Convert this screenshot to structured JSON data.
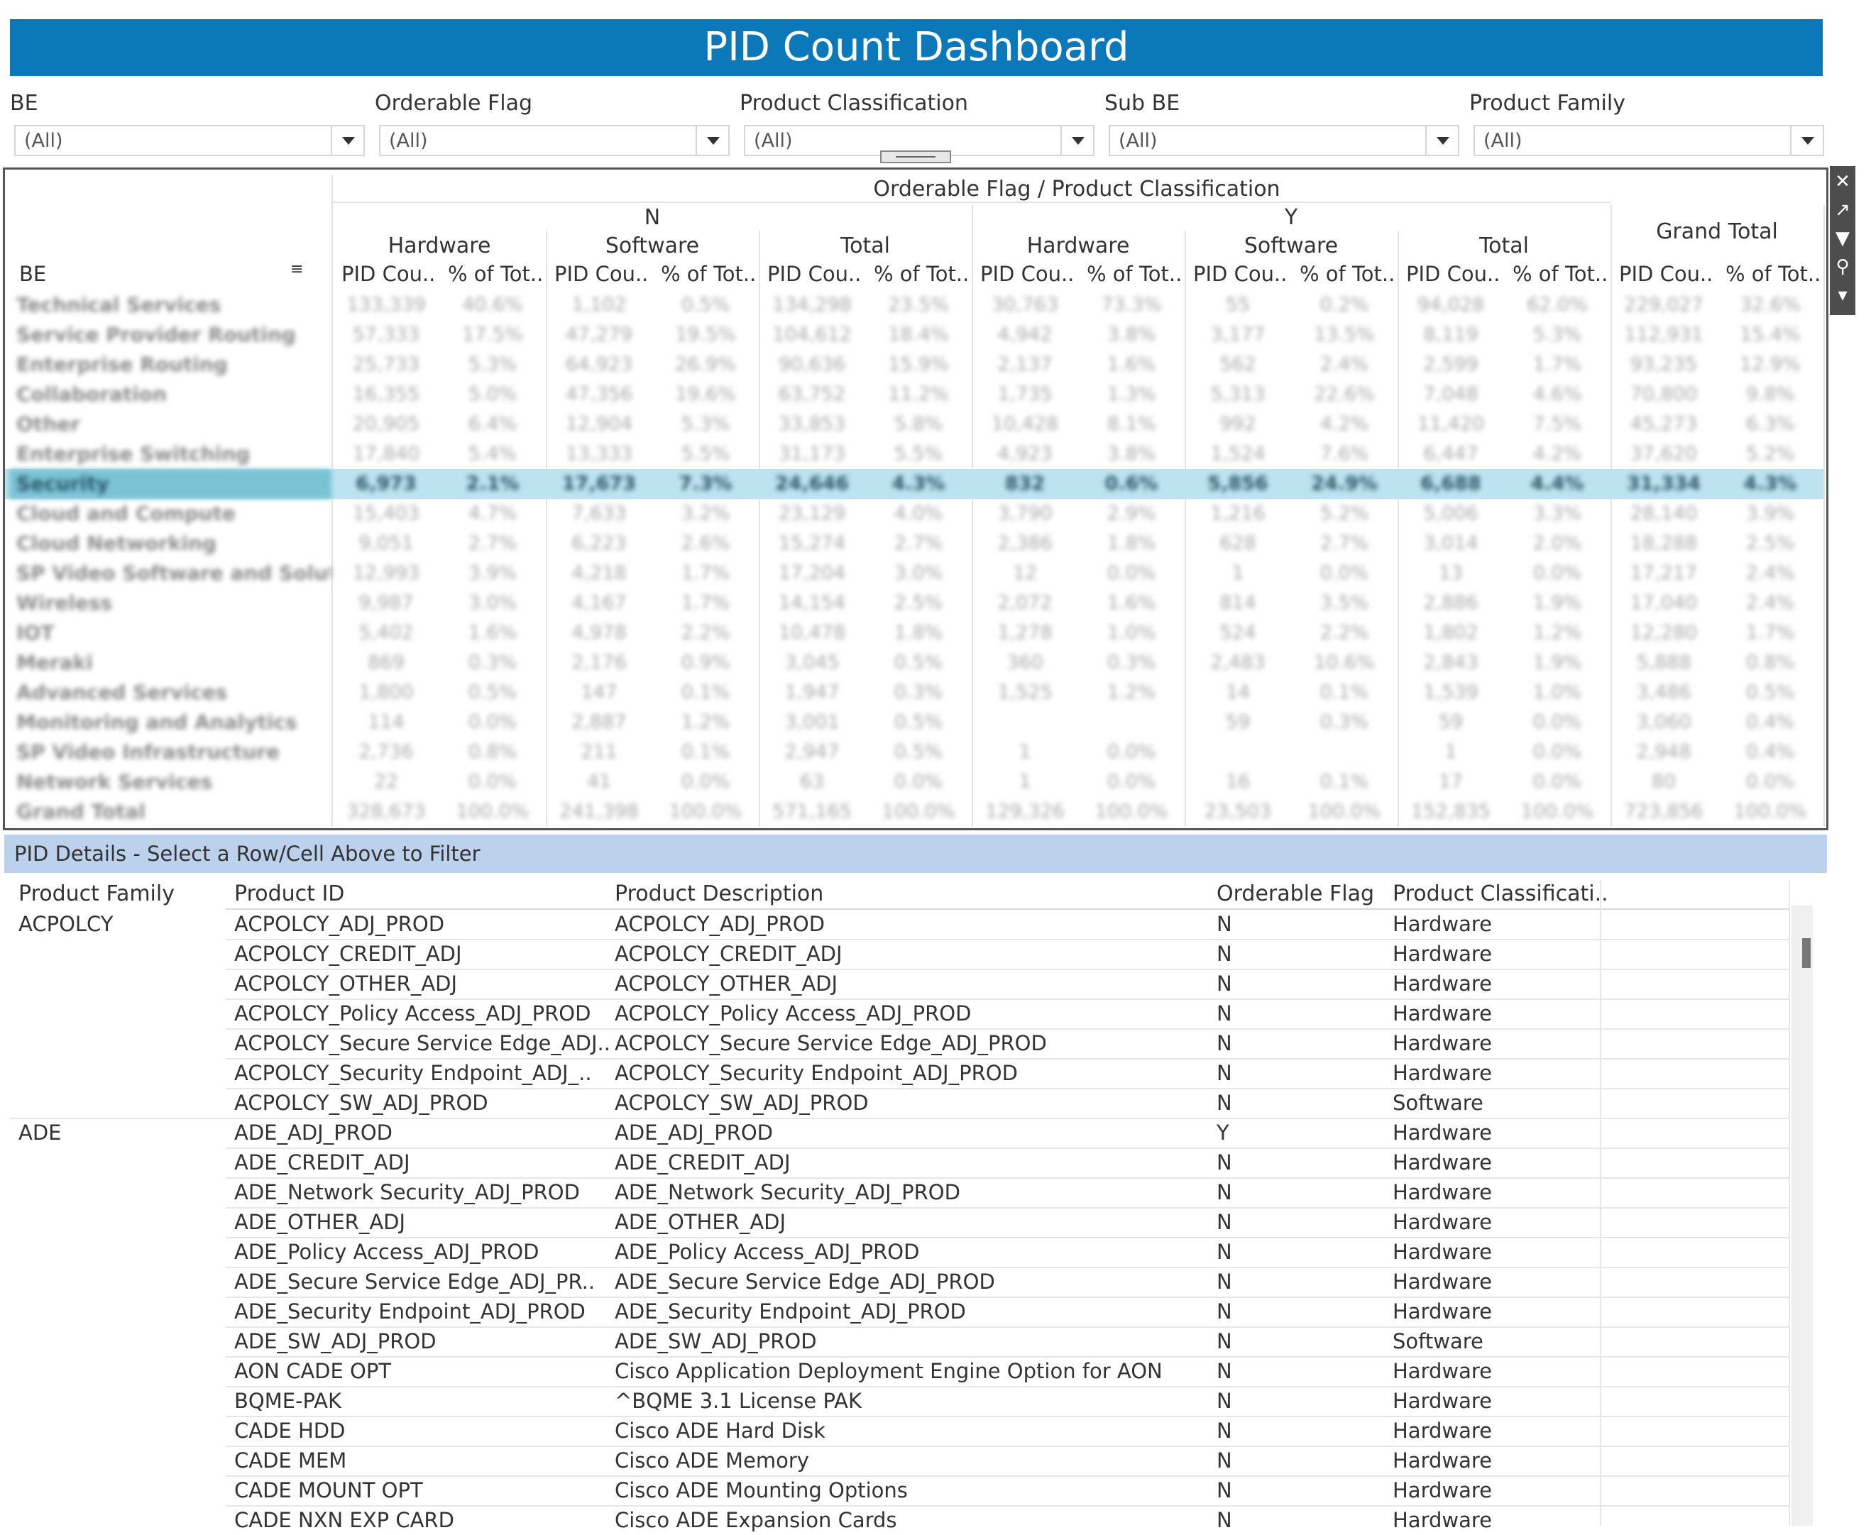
{
  "title": "PID Count Dashboard",
  "filters": [
    {
      "label": "BE",
      "value": "(All)"
    },
    {
      "label": "Orderable Flag",
      "value": "(All)"
    },
    {
      "label": "Product Classification",
      "value": "(All)"
    },
    {
      "label": "Sub BE",
      "value": "(All)"
    },
    {
      "label": "Product Family",
      "value": "(All)"
    }
  ],
  "crosstab": {
    "column_title": "Orderable Flag / Product Classification",
    "row_header": "BE",
    "flags": [
      "N",
      "Y"
    ],
    "classes": [
      "Hardware",
      "Software",
      "Total",
      "Hardware",
      "Software",
      "Total"
    ],
    "grand_total": "Grand Total",
    "measures": [
      "PID Cou..",
      "% of Tot.."
    ],
    "rows": [
      {
        "be": "Technical Services",
        "cells": [
          "133,339",
          "40.6%",
          "1,102",
          "0.5%",
          "134,298",
          "23.5%",
          "30,763",
          "73.3%",
          "55",
          "0.2%",
          "94,028",
          "62.0%",
          "229,027",
          "32.6%"
        ]
      },
      {
        "be": "Service Provider Routing",
        "cells": [
          "57,333",
          "17.5%",
          "47,279",
          "19.5%",
          "104,612",
          "18.4%",
          "4,942",
          "3.8%",
          "3,177",
          "13.5%",
          "8,119",
          "5.3%",
          "112,931",
          "15.4%"
        ]
      },
      {
        "be": "Enterprise Routing",
        "cells": [
          "25,733",
          "5.3%",
          "64,923",
          "26.9%",
          "90,636",
          "15.9%",
          "2,137",
          "1.6%",
          "562",
          "2.4%",
          "2,599",
          "1.7%",
          "93,235",
          "12.9%"
        ]
      },
      {
        "be": "Collaboration",
        "cells": [
          "16,355",
          "5.0%",
          "47,356",
          "19.6%",
          "63,752",
          "11.2%",
          "1,735",
          "1.3%",
          "5,313",
          "22.6%",
          "7,048",
          "4.6%",
          "70,800",
          "9.8%"
        ]
      },
      {
        "be": "Other",
        "cells": [
          "20,905",
          "6.4%",
          "12,904",
          "5.3%",
          "33,853",
          "5.8%",
          "10,428",
          "8.1%",
          "992",
          "4.2%",
          "11,420",
          "7.5%",
          "45,273",
          "6.3%"
        ]
      },
      {
        "be": "Enterprise Switching",
        "cells": [
          "17,840",
          "5.4%",
          "13,333",
          "5.5%",
          "31,173",
          "5.5%",
          "4,923",
          "3.8%",
          "1,524",
          "7.6%",
          "6,447",
          "4.2%",
          "37,620",
          "5.2%"
        ]
      },
      {
        "be": "Security",
        "cells": [
          "6,973",
          "2.1%",
          "17,673",
          "7.3%",
          "24,646",
          "4.3%",
          "832",
          "0.6%",
          "5,856",
          "24.9%",
          "6,688",
          "4.4%",
          "31,334",
          "4.3%"
        ]
      },
      {
        "be": "Cloud and Compute",
        "cells": [
          "15,403",
          "4.7%",
          "7,633",
          "3.2%",
          "23,129",
          "4.0%",
          "3,790",
          "2.9%",
          "1,216",
          "5.2%",
          "5,006",
          "3.3%",
          "28,140",
          "3.9%"
        ]
      },
      {
        "be": "Cloud Networking",
        "cells": [
          "9,051",
          "2.7%",
          "6,223",
          "2.6%",
          "15,274",
          "2.7%",
          "2,386",
          "1.8%",
          "628",
          "2.7%",
          "3,014",
          "2.0%",
          "18,288",
          "2.5%"
        ]
      },
      {
        "be": "SP Video Software and Soluti..",
        "cells": [
          "12,993",
          "3.9%",
          "4,218",
          "1.7%",
          "17,204",
          "3.0%",
          "12",
          "0.0%",
          "1",
          "0.0%",
          "13",
          "0.0%",
          "17,217",
          "2.4%"
        ]
      },
      {
        "be": "Wireless",
        "cells": [
          "9,987",
          "3.0%",
          "4,167",
          "1.7%",
          "14,154",
          "2.5%",
          "2,072",
          "1.6%",
          "814",
          "3.5%",
          "2,886",
          "1.9%",
          "17,040",
          "2.4%"
        ]
      },
      {
        "be": "IOT",
        "cells": [
          "5,402",
          "1.6%",
          "4,978",
          "2.2%",
          "10,478",
          "1.8%",
          "1,278",
          "1.0%",
          "524",
          "2.2%",
          "1,802",
          "1.2%",
          "12,280",
          "1.7%"
        ]
      },
      {
        "be": "Meraki",
        "cells": [
          "869",
          "0.3%",
          "2,176",
          "0.9%",
          "3,045",
          "0.5%",
          "360",
          "0.3%",
          "2,483",
          "10.6%",
          "2,843",
          "1.9%",
          "5,888",
          "0.8%"
        ]
      },
      {
        "be": "Advanced Services",
        "cells": [
          "1,800",
          "0.5%",
          "147",
          "0.1%",
          "1,947",
          "0.3%",
          "1,525",
          "1.2%",
          "14",
          "0.1%",
          "1,539",
          "1.0%",
          "3,486",
          "0.5%"
        ]
      },
      {
        "be": "Monitoring and Analytics",
        "cells": [
          "114",
          "0.0%",
          "2,887",
          "1.2%",
          "3,001",
          "0.5%",
          "",
          "",
          "59",
          "0.3%",
          "59",
          "0.0%",
          "3,060",
          "0.4%"
        ]
      },
      {
        "be": "SP Video Infrastructure",
        "cells": [
          "2,736",
          "0.8%",
          "211",
          "0.1%",
          "2,947",
          "0.5%",
          "1",
          "0.0%",
          "",
          "",
          "1",
          "0.0%",
          "2,948",
          "0.4%"
        ]
      },
      {
        "be": "Network Services",
        "cells": [
          "22",
          "0.0%",
          "41",
          "0.0%",
          "63",
          "0.0%",
          "1",
          "0.0%",
          "16",
          "0.1%",
          "17",
          "0.0%",
          "80",
          "0.0%"
        ]
      },
      {
        "be": "Grand Total",
        "cells": [
          "328,673",
          "100.0%",
          "241,398",
          "100.0%",
          "571,165",
          "100.0%",
          "129,326",
          "100.0%",
          "23,503",
          "100.0%",
          "152,835",
          "100.0%",
          "723,856",
          "100.0%"
        ]
      }
    ],
    "selected_row": 6
  },
  "details": {
    "title": "PID Details - Select a Row/Cell Above to Filter",
    "headers": [
      "Product Family",
      "Product ID",
      "Product Description",
      "Orderable Flag",
      "Product Classificati.."
    ],
    "rows": [
      {
        "family": "ACPOLCY",
        "id": "ACPOLCY_ADJ_PROD",
        "desc": "ACPOLCY_ADJ_PROD",
        "flag": "N",
        "cls": "Hardware"
      },
      {
        "family": "",
        "id": "ACPOLCY_CREDIT_ADJ",
        "desc": "ACPOLCY_CREDIT_ADJ",
        "flag": "N",
        "cls": "Hardware"
      },
      {
        "family": "",
        "id": "ACPOLCY_OTHER_ADJ",
        "desc": "ACPOLCY_OTHER_ADJ",
        "flag": "N",
        "cls": "Hardware"
      },
      {
        "family": "",
        "id": "ACPOLCY_Policy  Access_ADJ_PROD",
        "desc": "ACPOLCY_Policy  Access_ADJ_PROD",
        "flag": "N",
        "cls": "Hardware"
      },
      {
        "family": "",
        "id": "ACPOLCY_Secure Service Edge_ADJ..",
        "desc": "ACPOLCY_Secure Service Edge_ADJ_PROD",
        "flag": "N",
        "cls": "Hardware"
      },
      {
        "family": "",
        "id": "ACPOLCY_Security Endpoint_ADJ_..",
        "desc": "ACPOLCY_Security Endpoint_ADJ_PROD",
        "flag": "N",
        "cls": "Hardware"
      },
      {
        "family": "",
        "id": "ACPOLCY_SW_ADJ_PROD",
        "desc": "ACPOLCY_SW_ADJ_PROD",
        "flag": "N",
        "cls": "Software"
      },
      {
        "family": "ADE",
        "id": "ADE_ADJ_PROD",
        "desc": "ADE_ADJ_PROD",
        "flag": "Y",
        "cls": "Hardware"
      },
      {
        "family": "",
        "id": "ADE_CREDIT_ADJ",
        "desc": "ADE_CREDIT_ADJ",
        "flag": "N",
        "cls": "Hardware"
      },
      {
        "family": "",
        "id": "ADE_Network Security_ADJ_PROD",
        "desc": "ADE_Network Security_ADJ_PROD",
        "flag": "N",
        "cls": "Hardware"
      },
      {
        "family": "",
        "id": "ADE_OTHER_ADJ",
        "desc": "ADE_OTHER_ADJ",
        "flag": "N",
        "cls": "Hardware"
      },
      {
        "family": "",
        "id": "ADE_Policy  Access_ADJ_PROD",
        "desc": "ADE_Policy  Access_ADJ_PROD",
        "flag": "N",
        "cls": "Hardware"
      },
      {
        "family": "",
        "id": "ADE_Secure Service Edge_ADJ_PR..",
        "desc": "ADE_Secure Service Edge_ADJ_PROD",
        "flag": "N",
        "cls": "Hardware"
      },
      {
        "family": "",
        "id": "ADE_Security Endpoint_ADJ_PROD",
        "desc": "ADE_Security Endpoint_ADJ_PROD",
        "flag": "N",
        "cls": "Hardware"
      },
      {
        "family": "",
        "id": "ADE_SW_ADJ_PROD",
        "desc": "ADE_SW_ADJ_PROD",
        "flag": "N",
        "cls": "Software"
      },
      {
        "family": "",
        "id": "AON CADE OPT",
        "desc": "Cisco Application Deployment Engine Option for AON",
        "flag": "N",
        "cls": "Hardware"
      },
      {
        "family": "",
        "id": "BQME-PAK",
        "desc": "^BQME 3.1 License PAK",
        "flag": "N",
        "cls": "Hardware"
      },
      {
        "family": "",
        "id": "CADE HDD",
        "desc": "Cisco ADE Hard Disk",
        "flag": "N",
        "cls": "Hardware"
      },
      {
        "family": "",
        "id": "CADE MEM",
        "desc": "Cisco ADE Memory",
        "flag": "N",
        "cls": "Hardware"
      },
      {
        "family": "",
        "id": "CADE MOUNT OPT",
        "desc": "Cisco ADE Mounting Options",
        "flag": "N",
        "cls": "Hardware"
      },
      {
        "family": "",
        "id": "CADE NXN EXP CARD",
        "desc": "Cisco ADE Expansion Cards",
        "flag": "N",
        "cls": "Hardware"
      }
    ]
  },
  "toolbar": {
    "icons": [
      "close-icon",
      "popout-icon",
      "filter-icon",
      "pin-icon",
      "more-icon"
    ],
    "glyphs": [
      "✕",
      "↗",
      "▼",
      "⚲",
      "▾"
    ]
  },
  "colors": {
    "title_bar": "#0a78b9",
    "selected_row": "#bde3f0",
    "selected_row_header": "#79c3d5",
    "details_title_bg": "#bcd2ec"
  }
}
